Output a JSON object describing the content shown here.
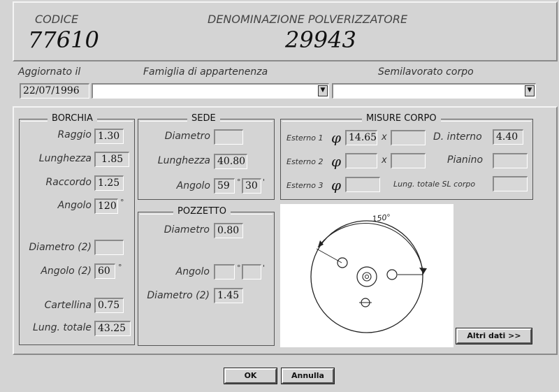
{
  "header": {
    "codice_label": "CODICE",
    "codice_value": "77610",
    "denominazione_label": "DENOMINAZIONE POLVERIZZATORE",
    "denominazione_value": "29943"
  },
  "info": {
    "aggiornato_label": "Aggiornato il",
    "aggiornato_value": "22/07/1996",
    "famiglia_label": "Famiglia di appartenenza",
    "famiglia_value": "",
    "semilavorato_label": "Semilavorato corpo",
    "semilavorato_value": ""
  },
  "borchia": {
    "title": "BORCHIA",
    "raggio_label": "Raggio",
    "raggio_value": "1.30",
    "lunghezza_label": "Lunghezza",
    "lunghezza_value": "1.85",
    "raccordo_label": "Raccordo",
    "raccordo_value": "1.25",
    "angolo_label": "Angolo",
    "angolo_value": "120",
    "angolo_unit": "°",
    "diametro2_label": "Diametro (2)",
    "diametro2_value": "",
    "angolo2_label": "Angolo (2)",
    "angolo2_value": "60",
    "angolo2_unit": "°",
    "cartellina_label": "Cartellina",
    "cartellina_value": "0.75",
    "lung_totale_label": "Lung. totale",
    "lung_totale_value": "43.25"
  },
  "sede": {
    "title": "SEDE",
    "diametro_label": "Diametro",
    "diametro_value": "",
    "lunghezza_label": "Lunghezza",
    "lunghezza_value": "40.80",
    "angolo_label": "Angolo",
    "angolo_deg": "59",
    "angolo_deg_unit": "°",
    "angolo_min": "30",
    "angolo_min_unit": "'"
  },
  "pozzetto": {
    "title": "POZZETTO",
    "diametro_label": "Diametro",
    "diametro_value": "0.80",
    "angolo_label": "Angolo",
    "angolo_deg": "",
    "angolo_deg_unit": "°",
    "angolo_min": "",
    "angolo_min_unit": "'",
    "diametro2_label": "Diametro (2)",
    "diametro2_value": "1.45"
  },
  "misure": {
    "title": "MISURE CORPO",
    "phi": "φ",
    "x": "x",
    "esterno1_label": "Esterno 1",
    "esterno1_value": "14.65",
    "esterno1_x": "",
    "esterno2_label": "Esterno 2",
    "esterno2_value": "",
    "esterno2_x": "",
    "esterno3_label": "Esterno 3",
    "esterno3_value": "",
    "d_interno_label": "D. interno",
    "d_interno_value": "4.40",
    "pianino_label": "Pianino",
    "pianino_value": "",
    "lung_totale_sl_label": "Lung. totale SL corpo",
    "lung_totale_sl_value": ""
  },
  "drawing": {
    "angle_label": "150°"
  },
  "buttons": {
    "altri_dati": "Altri dati >>",
    "ok": "OK",
    "annulla": "Annulla"
  },
  "icons": {
    "dropdown": "▼"
  }
}
